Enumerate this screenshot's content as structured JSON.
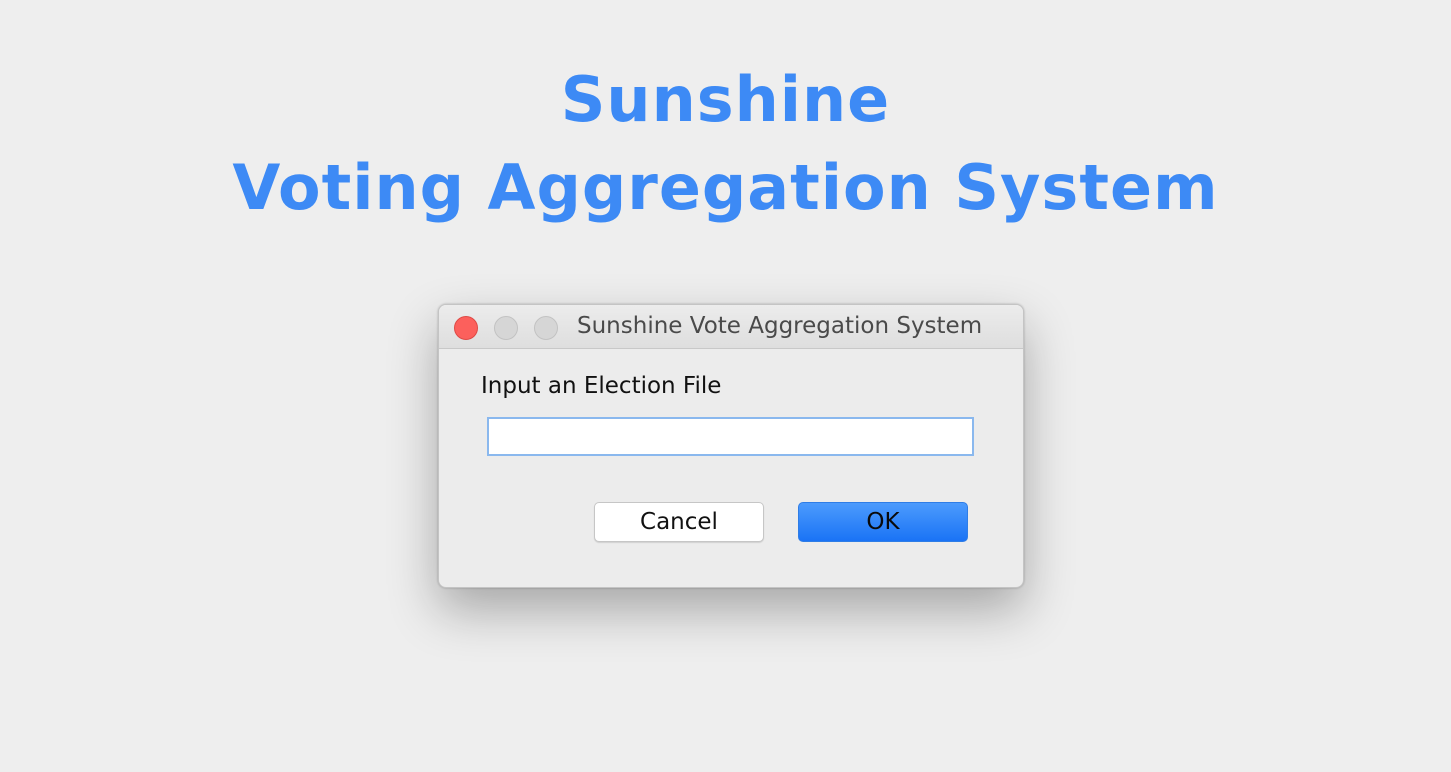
{
  "hero": {
    "line1": "Sunshine",
    "line2": "Voting Aggregation System"
  },
  "dialog": {
    "window_title": "Sunshine Vote Aggregation System",
    "prompt": "Input an Election File",
    "input_value": "",
    "cancel_label": "Cancel",
    "ok_label": "OK"
  },
  "colors": {
    "hero_text": "#3d8af5",
    "close_button": "#fc605c",
    "ok_button": "#1a73f5"
  }
}
